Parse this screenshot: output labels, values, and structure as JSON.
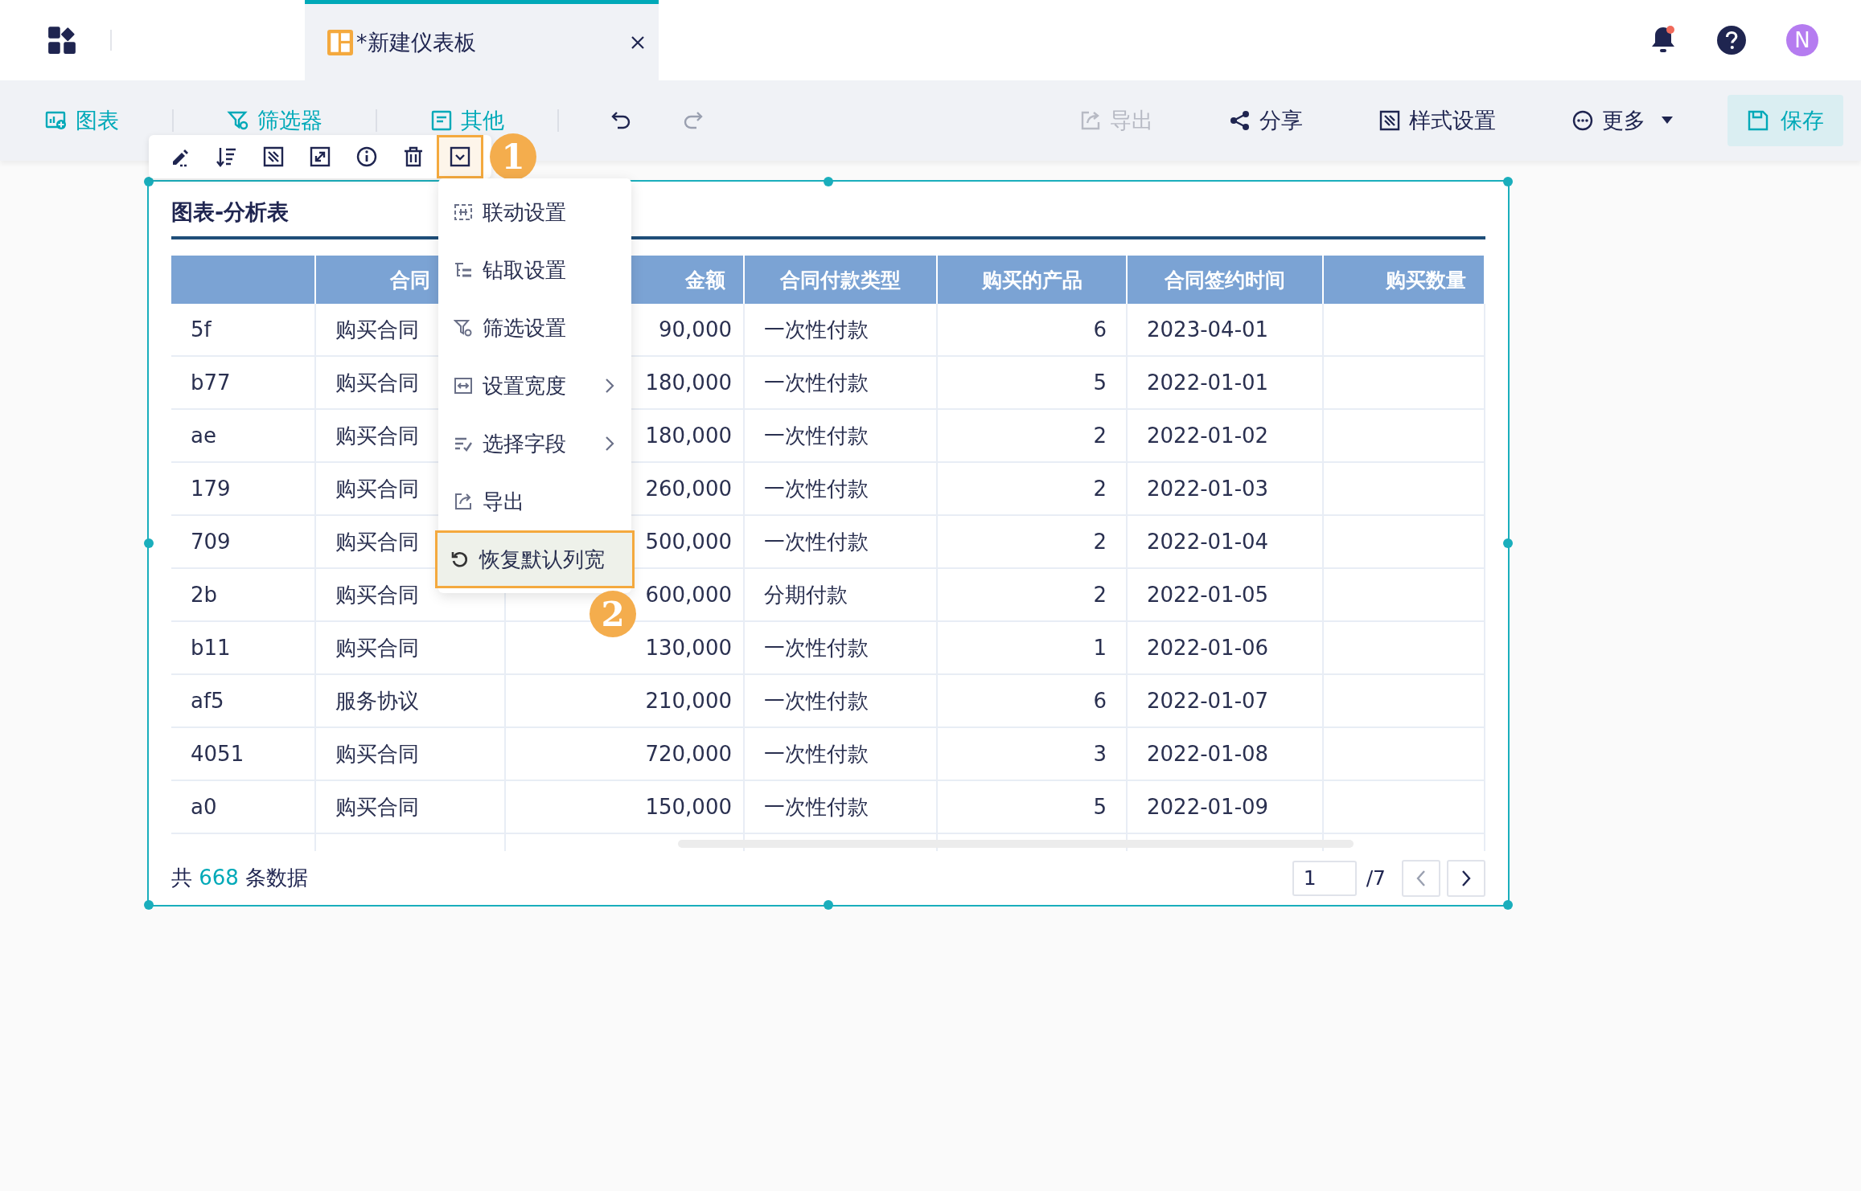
{
  "app_bar": {
    "tab": {
      "title": "*新建仪表板",
      "selected": true
    },
    "notification_dot": true,
    "avatar": "N"
  },
  "toolbar": {
    "left": [
      {
        "label": "图表",
        "kind": "chart"
      },
      {
        "label": "筛选器",
        "kind": "filter"
      },
      {
        "label": "其他",
        "kind": "other"
      }
    ],
    "undo": {
      "disabled": false
    },
    "redo": {
      "disabled": true
    },
    "right": [
      {
        "label": "导出",
        "kind": "export",
        "disabled": true
      },
      {
        "label": "分享",
        "kind": "share",
        "disabled": false
      },
      {
        "label": "样式设置",
        "kind": "style",
        "disabled": false
      },
      {
        "label": "更多",
        "kind": "more",
        "disabled": false
      }
    ],
    "save": "保存"
  },
  "widget_tools": [
    {
      "kind": "edit",
      "selected": false
    },
    {
      "kind": "sort",
      "selected": false
    },
    {
      "kind": "style",
      "selected": false
    },
    {
      "kind": "expand",
      "selected": false
    },
    {
      "kind": "info",
      "selected": false
    },
    {
      "kind": "delete",
      "selected": false
    },
    {
      "kind": "dropdown",
      "selected": true
    }
  ],
  "markers": [
    "1",
    "2"
  ],
  "menu": [
    {
      "label": "联动设置",
      "kind": "link",
      "submenu": false,
      "selected": false
    },
    {
      "label": "钻取设置",
      "kind": "drill",
      "submenu": false,
      "selected": false
    },
    {
      "label": "筛选设置",
      "kind": "filter",
      "submenu": false,
      "selected": false
    },
    {
      "label": "设置宽度",
      "kind": "width",
      "submenu": true,
      "selected": false
    },
    {
      "label": "选择字段",
      "kind": "fields",
      "submenu": true,
      "selected": false
    },
    {
      "label": "导出",
      "kind": "export",
      "submenu": false,
      "selected": false
    },
    {
      "label": "恢复默认列宽",
      "kind": "reset",
      "submenu": false,
      "selected": true
    }
  ],
  "widget": {
    "title": "图表-分析表",
    "table": {
      "columns": [
        {},
        {
          "label": "合同"
        },
        {
          "label": "金额"
        },
        {
          "label": "合同付款类型"
        },
        {
          "label": "购买的产品"
        },
        {
          "label": "合同签约时间"
        },
        {
          "label": "购买数量"
        }
      ],
      "rows": [
        [
          "5f",
          "购买合同",
          "90,000",
          "一次性付款",
          "6",
          "2023-04-01"
        ],
        [
          "b77",
          "购买合同",
          "180,000",
          "一次性付款",
          "5",
          "2022-01-01"
        ],
        [
          "ae",
          "购买合同",
          "180,000",
          "一次性付款",
          "2",
          "2022-01-02"
        ],
        [
          "179",
          "购买合同",
          "260,000",
          "一次性付款",
          "2",
          "2022-01-03"
        ],
        [
          "709",
          "购买合同",
          "500,000",
          "一次性付款",
          "2",
          "2022-01-04"
        ],
        [
          "2b",
          "购买合同",
          "600,000",
          "分期付款",
          "2",
          "2022-01-05"
        ],
        [
          "b11",
          "购买合同",
          "130,000",
          "一次性付款",
          "1",
          "2022-01-06"
        ],
        [
          "af5",
          "服务协议",
          "210,000",
          "一次性付款",
          "6",
          "2022-01-07"
        ],
        [
          "4051",
          "购买合同",
          "720,000",
          "一次性付款",
          "3",
          "2022-01-08"
        ],
        [
          "a0",
          "购买合同",
          "150,000",
          "一次性付款",
          "5",
          "2022-01-09"
        ]
      ]
    },
    "footer": {
      "prefix": "共",
      "count": "668",
      "suffix": "条数据"
    },
    "pagination": {
      "page": "1",
      "total": "/7",
      "prev_disabled": true
    }
  }
}
